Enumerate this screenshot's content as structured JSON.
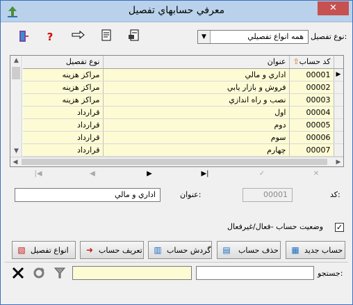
{
  "window": {
    "title": "معرفي حسابهاي تفصيل",
    "close_glyph": "✕"
  },
  "toolbar": {
    "type_label": "نوع تفصيل:",
    "type_selected": "همه انواع تفصيلي",
    "icons": [
      "exit-icon",
      "help-icon",
      "pointer-icon",
      "print-preview-icon",
      "export-icon"
    ]
  },
  "grid": {
    "columns": {
      "code": "كد حساب",
      "title": "عنوان",
      "type": "نوع تفصيل"
    },
    "rows": [
      {
        "code": "00001",
        "title": "اداري و مالي",
        "type": "مراكز هزينه",
        "current": true
      },
      {
        "code": "00002",
        "title": "فروش و بازار يابي",
        "type": "مراكز هزينه"
      },
      {
        "code": "00003",
        "title": "نصب و راه اندازي",
        "type": "مراكز هزينه"
      },
      {
        "code": "00004",
        "title": "اول",
        "type": "قرارداد"
      },
      {
        "code": "00005",
        "title": "دوم",
        "type": "قرارداد"
      },
      {
        "code": "00006",
        "title": "سوم",
        "type": "قرارداد"
      },
      {
        "code": "00007",
        "title": "چهارم",
        "type": "قرارداد"
      }
    ]
  },
  "detail": {
    "code_label": "كد:",
    "code_value": "00001",
    "title_label": "عنوان:",
    "title_value": "اداري و مالي",
    "status_label": "وضعيت حساب -فعال/غيرفعال",
    "status_checked": "✓"
  },
  "buttons": {
    "new_account": "حساب جديد",
    "delete_account": "حذف حساب",
    "account_turnover": "گردش حساب",
    "define_account": "تعريف حساب",
    "detail_types": "انواع تفصيل"
  },
  "search": {
    "label": "جستجو:",
    "value": ""
  },
  "colors": {
    "grid_row_bg": "#fdfbd4",
    "title_bar": "#b9d1ea",
    "close_button": "#c75050"
  }
}
